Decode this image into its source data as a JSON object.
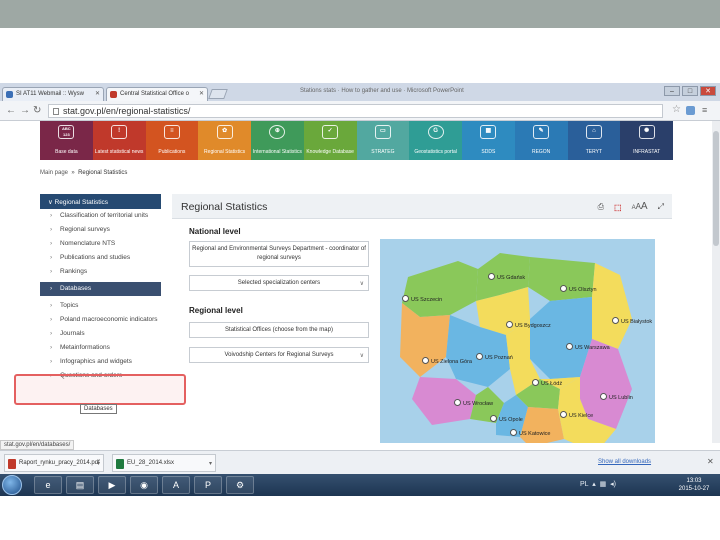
{
  "browser": {
    "tabs": [
      {
        "label": "SI AT11 Webmail :: Wysw"
      },
      {
        "label": "Central Statistical Office o"
      }
    ],
    "window_title": "Stations stats · How to gather and use · Microsoft PowerPoint",
    "url": "stat.gov.pl/en/regional-statistics/"
  },
  "iconbar": [
    {
      "label": "Base data",
      "glyph": "ABC 123",
      "color": "#7a2748"
    },
    {
      "label": "Latest statistical news",
      "glyph": "!",
      "color": "#c0392b"
    },
    {
      "label": "Publications",
      "glyph": "≡",
      "color": "#d35420"
    },
    {
      "label": "Regional Statistics",
      "glyph": "✿",
      "color": "#e08a2a"
    },
    {
      "label": "International Statistics",
      "glyph": "⊕",
      "color": "#3f9a5a"
    },
    {
      "label": "Knowledge Database",
      "glyph": "✓",
      "color": "#6aa83b"
    },
    {
      "label": "STRATEG",
      "glyph": "▭",
      "color": "#52a8a0"
    },
    {
      "label": "Geostatistics portal",
      "glyph": "G",
      "color": "#2f9d95"
    },
    {
      "label": "SDDS",
      "glyph": "▦",
      "color": "#2e8bc0"
    },
    {
      "label": "REGON",
      "glyph": "✎",
      "color": "#2b7ab5"
    },
    {
      "label": "TERYT",
      "glyph": "⌂",
      "color": "#2a5f9a"
    },
    {
      "label": "INFRASTAT",
      "glyph": "✺",
      "color": "#2a3f6a"
    }
  ],
  "breadcrumb": {
    "home": "Main page",
    "sep": "»",
    "current": "Regional Statistics"
  },
  "sidebar": {
    "title": "Regional Statistics",
    "items": [
      {
        "label": "Classification of territorial units"
      },
      {
        "label": "Regional surveys"
      },
      {
        "label": "Nomenclature NTS"
      },
      {
        "label": "Publications and studies"
      },
      {
        "label": "Rankings"
      },
      {
        "label": "Databases"
      },
      {
        "label": "Topics"
      },
      {
        "label": "Poland macroeconomic indicators"
      },
      {
        "label": "Journals"
      },
      {
        "label": "Metainformations"
      },
      {
        "label": "Infographics and widgets"
      },
      {
        "label": "Questions and orders"
      }
    ],
    "selected_index": 5,
    "tooltip": "Databases"
  },
  "content": {
    "title": "Regional Statistics",
    "national_level": "National level",
    "dept_button": "Regional and Environmental Surveys Department - coordinator of regional surveys",
    "centers_select": "Selected specialization centers",
    "regional_level": "Regional level",
    "offices_button": "Statistical Offices (choose from the map)",
    "voivodship_select": "Voivodship Centers for Regional Surveys"
  },
  "map": {
    "offices": [
      "US Gdańsk",
      "US Olsztyn",
      "US Szczecin",
      "US Bydgoszcz",
      "US Białystok",
      "US Zielona Góra",
      "US Poznań",
      "US Warszawa",
      "US Łódź",
      "US Wrocław",
      "US Opole",
      "US Kielce",
      "US Lublin",
      "US Katowice",
      "US Rzeszów"
    ]
  },
  "status_url": "stat.gov.pl/en/databases/",
  "downloads": [
    {
      "name": "Raport_rynku_pracy_2014.pdf",
      "color": "#c0392b"
    },
    {
      "name": "EU_28_2014.xlsx",
      "color": "#1f7a3f"
    }
  ],
  "show_all": "Show all downloads",
  "clock": {
    "time": "13:03",
    "date": "2015-10-27"
  },
  "tray_lang": "PL"
}
